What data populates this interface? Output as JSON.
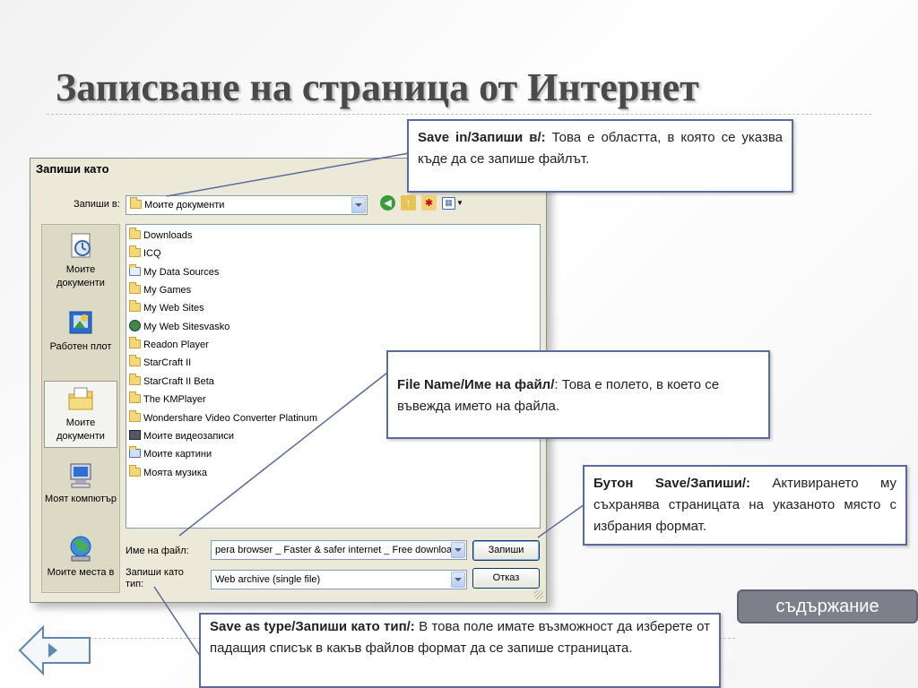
{
  "slide": {
    "title": "Записване на страница от Интернет",
    "contents_button": "съдържание"
  },
  "dialog": {
    "title": "Запиши като",
    "save_in_label": "Запиши в:",
    "save_in_value": "Моите документи",
    "places": [
      {
        "label": "Моите документи",
        "icon": "my-documents-icon"
      },
      {
        "label": "Работен плот",
        "icon": "desktop-icon"
      },
      {
        "label": "Моите документи",
        "icon": "my-documents-folder-icon"
      },
      {
        "label": "Моят компютър",
        "icon": "my-computer-icon"
      },
      {
        "label": "Моите места в",
        "icon": "network-places-icon"
      }
    ],
    "files": [
      {
        "name": "Downloads",
        "icon": "folder"
      },
      {
        "name": "ICQ",
        "icon": "folder"
      },
      {
        "name": "My Data Sources",
        "icon": "data-folder"
      },
      {
        "name": "My Games",
        "icon": "folder"
      },
      {
        "name": "My Web Sites",
        "icon": "folder"
      },
      {
        "name": "My Web Sitesvasko",
        "icon": "web-folder"
      },
      {
        "name": "Readon Player",
        "icon": "folder"
      },
      {
        "name": "StarCraft II",
        "icon": "folder"
      },
      {
        "name": "StarCraft II Beta",
        "icon": "folder"
      },
      {
        "name": "The KMPlayer",
        "icon": "folder"
      },
      {
        "name": "Wondershare Video Converter Platinum",
        "icon": "folder"
      },
      {
        "name": "Моите видеозаписи",
        "icon": "video-folder"
      },
      {
        "name": "Моите картини",
        "icon": "pictures-folder"
      },
      {
        "name": "Моята музика",
        "icon": "music-folder"
      }
    ],
    "filename_label": "Име на файл:",
    "filename_value": "pera browser _ Faster & safer internet _ Free download",
    "savetype_label": "Запиши като тип:",
    "savetype_value": "Web archive (single file)",
    "save_button": "Запиши",
    "cancel_button": "Отказ"
  },
  "callouts": {
    "save_in": {
      "bold": "Save in/Запиши в/:",
      "text": "  Това е областта, в която се указва къде да се запише файлът."
    },
    "file_name": {
      "bold": "File Name/Име на файл/",
      "text": ": Това е полето, в което се въвежда името на файла."
    },
    "save_button": {
      "bold": "Бутон Save/Запиши/:",
      "text": " Активирането му съхранява страницата на указаното място с избрания формат."
    },
    "save_type": {
      "bold": "Save as type/Запиши като тип/:",
      "text": " В това поле имате възможност да изберете от падащия списък в какъв файлов формат да се запише страницата."
    }
  }
}
